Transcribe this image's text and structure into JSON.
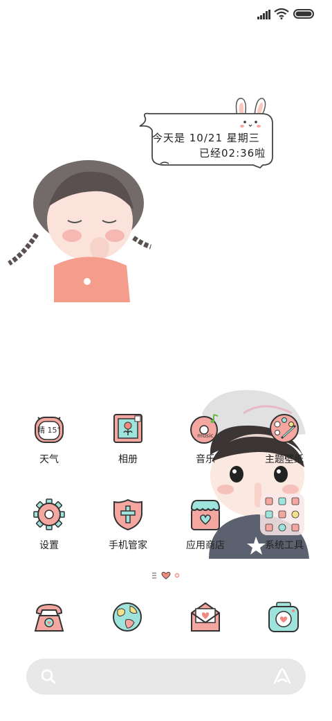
{
  "widget": {
    "line1": "今天是 10/21  星期三",
    "line2": "已经02:36啦"
  },
  "apps": [
    {
      "label": "天气",
      "icon": "weather-icon",
      "badge_text": "晴 15°"
    },
    {
      "label": "相册",
      "icon": "gallery-icon"
    },
    {
      "label": "音乐",
      "icon": "music-icon",
      "badge_text": "music"
    },
    {
      "label": "主题壁纸",
      "icon": "themes-icon"
    },
    {
      "label": "设置",
      "icon": "settings-icon"
    },
    {
      "label": "手机管家",
      "icon": "security-icon"
    },
    {
      "label": "应用商店",
      "icon": "app-store-icon"
    },
    {
      "label": "系统工具",
      "icon": "system-tools-folder-icon"
    }
  ],
  "dock": [
    {
      "icon": "phone-icon"
    },
    {
      "icon": "browser-icon"
    },
    {
      "icon": "messages-icon"
    },
    {
      "icon": "camera-icon"
    }
  ],
  "colors": {
    "pink": "#f4a7a0",
    "coral": "#ef8a80",
    "mint": "#7fd6d0",
    "outline": "#333333",
    "search_bg": "#e8e8e8"
  }
}
